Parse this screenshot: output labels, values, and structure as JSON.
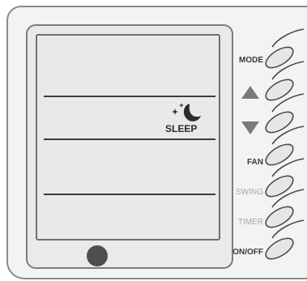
{
  "remote": {
    "display": {
      "mode_indicator": {
        "icon": "sleep-moon-stars-icon",
        "label": "SLEEP"
      }
    },
    "buttons": [
      {
        "id": "mode",
        "label": "MODE",
        "dimmed": false
      },
      {
        "id": "up",
        "label": "",
        "icon": "triangle-up-icon",
        "dimmed": false
      },
      {
        "id": "down",
        "label": "",
        "icon": "triangle-down-icon",
        "dimmed": false
      },
      {
        "id": "fan",
        "label": "FAN",
        "dimmed": false
      },
      {
        "id": "swing",
        "label": "SWING",
        "dimmed": true
      },
      {
        "id": "timer",
        "label": "TIMER",
        "dimmed": true
      },
      {
        "id": "onoff",
        "label": "ON/OFF",
        "dimmed": false
      }
    ]
  },
  "colors": {
    "panel": "#f3f3f3",
    "outline": "#4a4a4a",
    "dimmed_label": "#a8a8a8"
  }
}
